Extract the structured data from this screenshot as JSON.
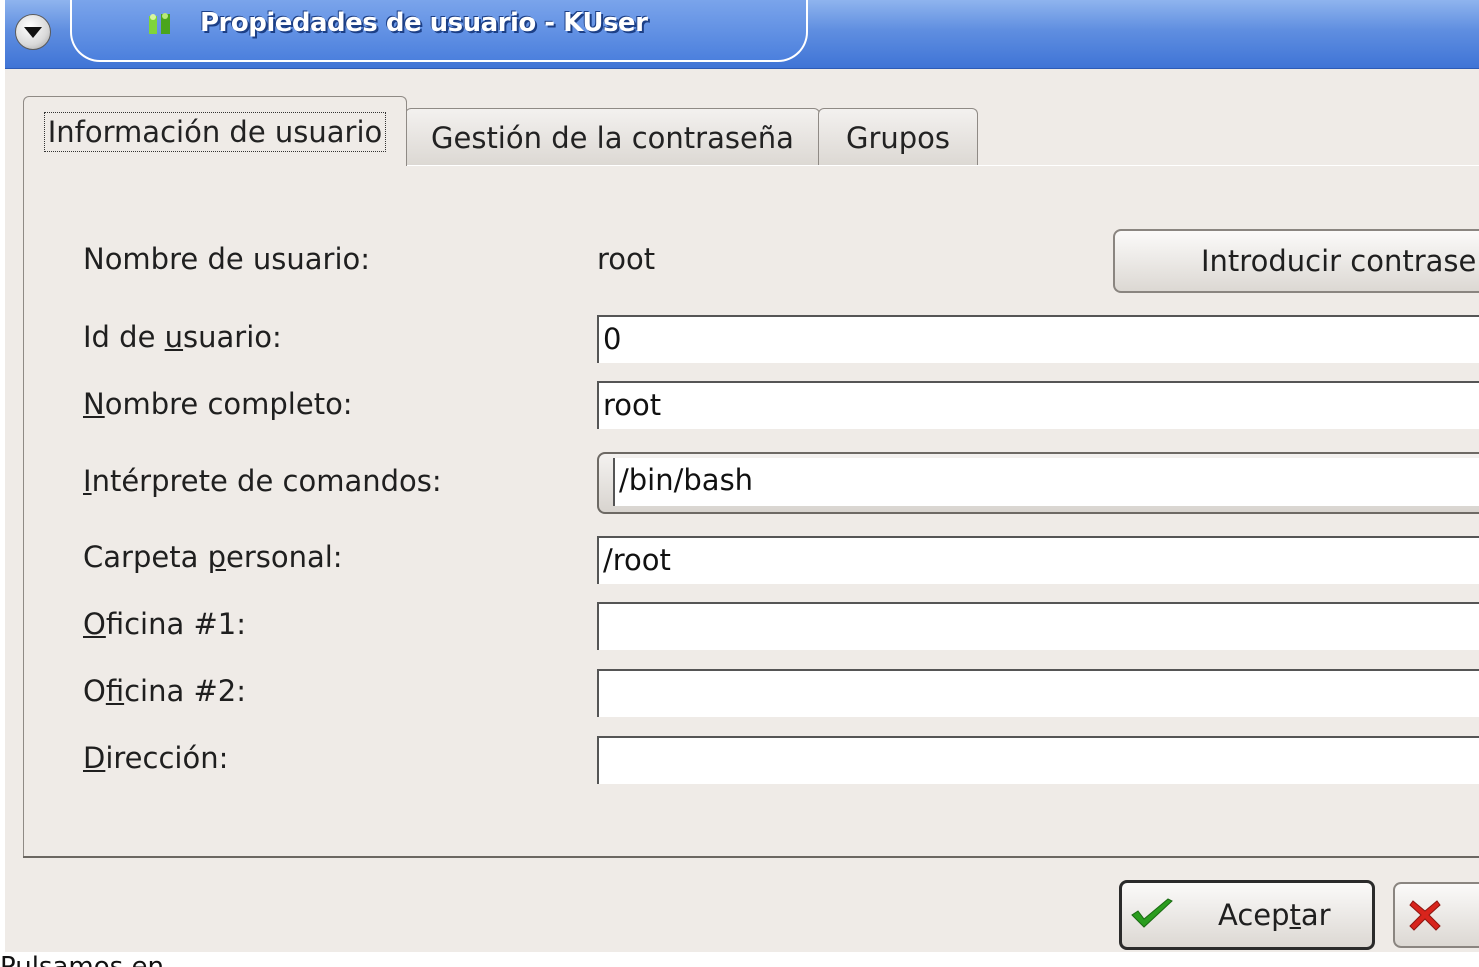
{
  "window": {
    "title": "Propiedades de usuario - KUser"
  },
  "tabs": [
    {
      "label": "Información de usuario",
      "active": true
    },
    {
      "label": "Gestión de la contraseña",
      "active": false
    },
    {
      "label": "Grupos",
      "active": false
    }
  ],
  "form": {
    "username_label": "Nombre de usuario:",
    "username_value": "root",
    "set_password_button": "Introducir contraseñ",
    "uid_label_pre": "Id de ",
    "uid_label_u": "u",
    "uid_label_post": "suario:",
    "uid_value": "0",
    "fullname_label_u": "N",
    "fullname_label_post": "ombre completo:",
    "fullname_value": "root",
    "shell_label_u": "I",
    "shell_label_post": "ntérprete de comandos:",
    "shell_value": "/bin/bash",
    "home_label_pre": "Carpeta ",
    "home_label_u": "p",
    "home_label_post": "ersonal:",
    "home_value": "/root",
    "office1_label_u": "O",
    "office1_label_post": "ficina #1:",
    "office1_value": "",
    "office2_label_pre": "O",
    "office2_label_u": "f",
    "office2_label_post": "icina #2:",
    "office2_value": "",
    "address_label_u": "D",
    "address_label_post": "irección:",
    "address_value": ""
  },
  "buttons": {
    "accept_pre": "Acep",
    "accept_u": "t",
    "accept_post": "ar"
  },
  "footer_text": "Pulsamos en",
  "icons": [
    "window-menu-icon",
    "users-icon",
    "checkmark-icon",
    "cancel-x-icon"
  ]
}
